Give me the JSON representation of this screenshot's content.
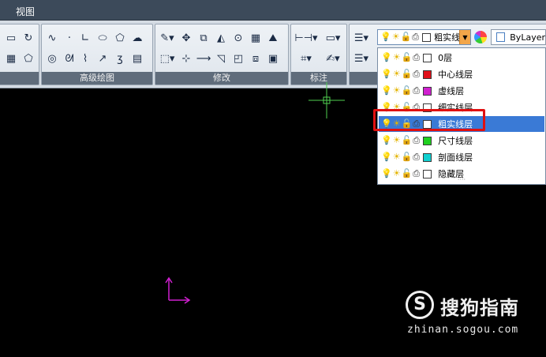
{
  "menu": {
    "view_label": "视图"
  },
  "panels": {
    "advanced_draw": "高级绘图",
    "modify": "修改",
    "annotate": "标注"
  },
  "layer_combo": {
    "current": "粗实线层"
  },
  "bylayer": {
    "label": "ByLayer"
  },
  "layers": [
    {
      "name": "0层",
      "color": "#ffffff",
      "selected": false
    },
    {
      "name": "中心线层",
      "color": "#e0101a",
      "selected": false
    },
    {
      "name": "虚线层",
      "color": "#d020d0",
      "selected": false
    },
    {
      "name": "细实线层",
      "color": "#ffffff",
      "selected": false
    },
    {
      "name": "粗实线层",
      "color": "#ffffff",
      "selected": true
    },
    {
      "name": "尺寸线层",
      "color": "#20d020",
      "selected": false
    },
    {
      "name": "剖面线层",
      "color": "#10d0d0",
      "selected": false
    },
    {
      "name": "隐藏层",
      "color": "#ffffff",
      "selected": false
    }
  ],
  "colors": {
    "highlight": "#e01010",
    "selected_row": "#3a7ad6",
    "crosshair": "#4fd04f",
    "ucs": "#d020d0"
  },
  "watermark": {
    "logo_letter": "S",
    "brand": "搜狗指南",
    "url": "zhinan.sogou.com"
  }
}
